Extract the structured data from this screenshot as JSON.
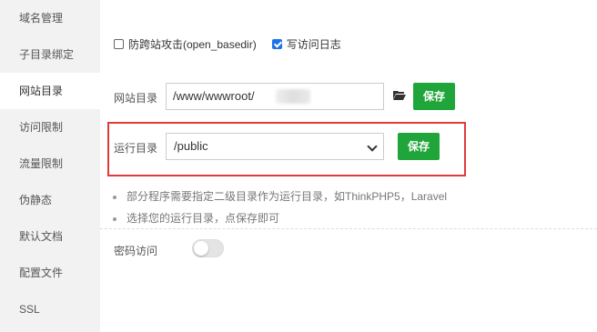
{
  "sidebar": {
    "items": [
      {
        "label": "域名管理"
      },
      {
        "label": "子目录绑定"
      },
      {
        "label": "网站目录"
      },
      {
        "label": "访问限制"
      },
      {
        "label": "流量限制"
      },
      {
        "label": "伪静态"
      },
      {
        "label": "默认文档"
      },
      {
        "label": "配置文件"
      },
      {
        "label": "SSL"
      }
    ],
    "active_index": 2
  },
  "options": {
    "open_basedir_label": "防跨站攻击(open_basedir)",
    "open_basedir_checked": false,
    "access_log_label": "写访问日志",
    "access_log_checked": true
  },
  "site_dir": {
    "label": "网站目录",
    "value": "/www/wwwroot/",
    "save_label": "保存"
  },
  "run_dir": {
    "label": "运行目录",
    "selected": "/public",
    "save_label": "保存"
  },
  "tips": [
    "部分程序需要指定二级目录作为运行目录，如ThinkPHP5，Laravel",
    "选择您的运行目录，点保存即可"
  ],
  "password_access": {
    "label": "密码访问",
    "enabled": false
  },
  "colors": {
    "accent_green": "#20a53a",
    "highlight_red": "#e03a3a",
    "checkbox_blue": "#1a73e8"
  }
}
